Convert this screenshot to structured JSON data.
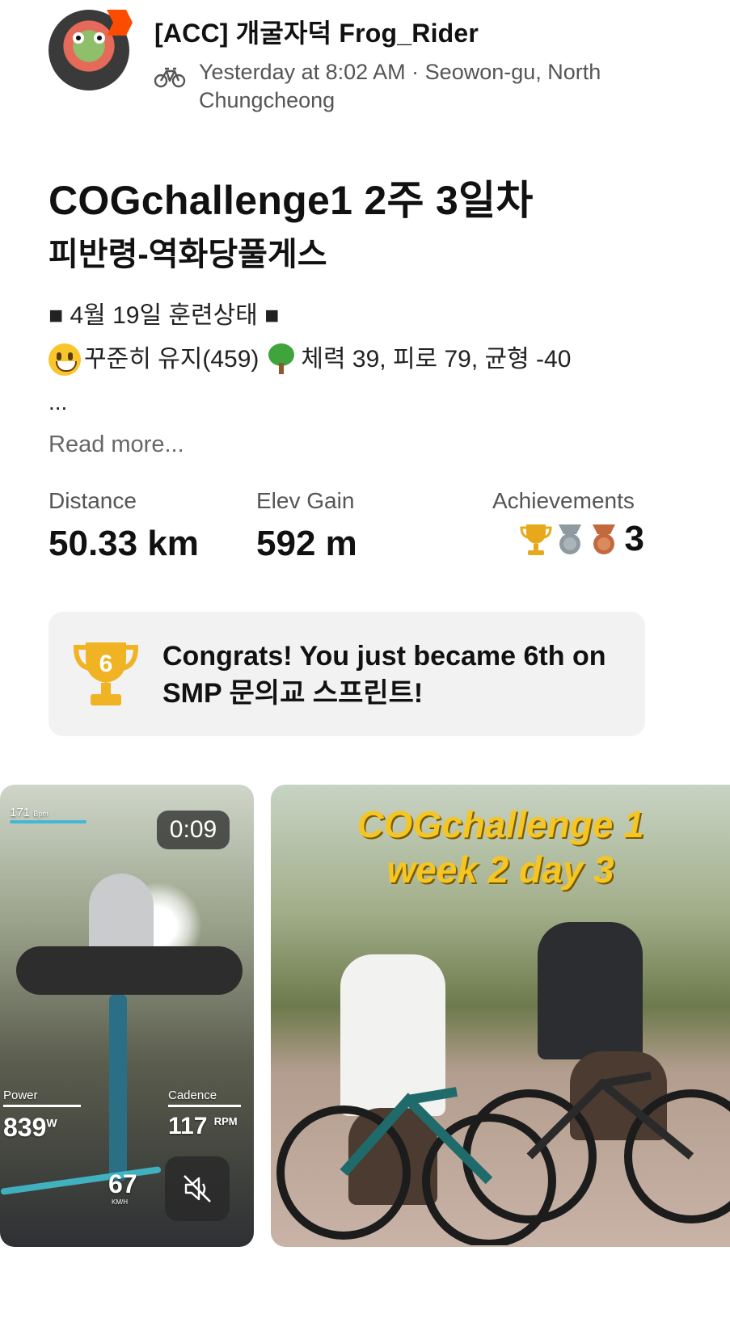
{
  "athlete": {
    "name": "[ACC] 개굴자덕 Frog_Rider",
    "meta": "Yesterday at 8:02 AM · Seowon-gu, North Chungcheong",
    "activity_icon": "bike-icon"
  },
  "activity": {
    "title": "COGchallenge1 2주 3일차",
    "subtitle": "피반령-역화당풀게스",
    "description": {
      "line1": "■ 4월 19일 훈련상태 ■",
      "line2_a": "꾸준히 유지(459)",
      "line2_b": "체력 39, 피로 79, 균형 -40",
      "ellipsis": "...",
      "read_more": "Read more..."
    }
  },
  "stats": {
    "distance_label": "Distance",
    "distance_value": "50.33 km",
    "elev_label": "Elev Gain",
    "elev_value": "592 m",
    "ach_label": "Achievements",
    "ach_count": "3",
    "medal_colors": [
      "#e7a81b",
      "#8e9aa0",
      "#c26a3d"
    ]
  },
  "congrats": {
    "rank": "6",
    "message": "Congrats! You just became 6th on SMP 문의교 스프린트!",
    "trophy_color": "#f0b323"
  },
  "media": {
    "video": {
      "duration": "0:09",
      "hr": "171",
      "hr_unit": "Bpm",
      "power_label": "Power",
      "power_value": "839",
      "power_unit": "W",
      "cadence_label": "Cadence",
      "cadence_value": "117",
      "cadence_unit": "RPM",
      "speed_value": "67",
      "speed_unit": "KM/H"
    },
    "photo": {
      "overlay_line1": "COGchallenge 1",
      "overlay_line2": "week 2 day 3"
    }
  }
}
